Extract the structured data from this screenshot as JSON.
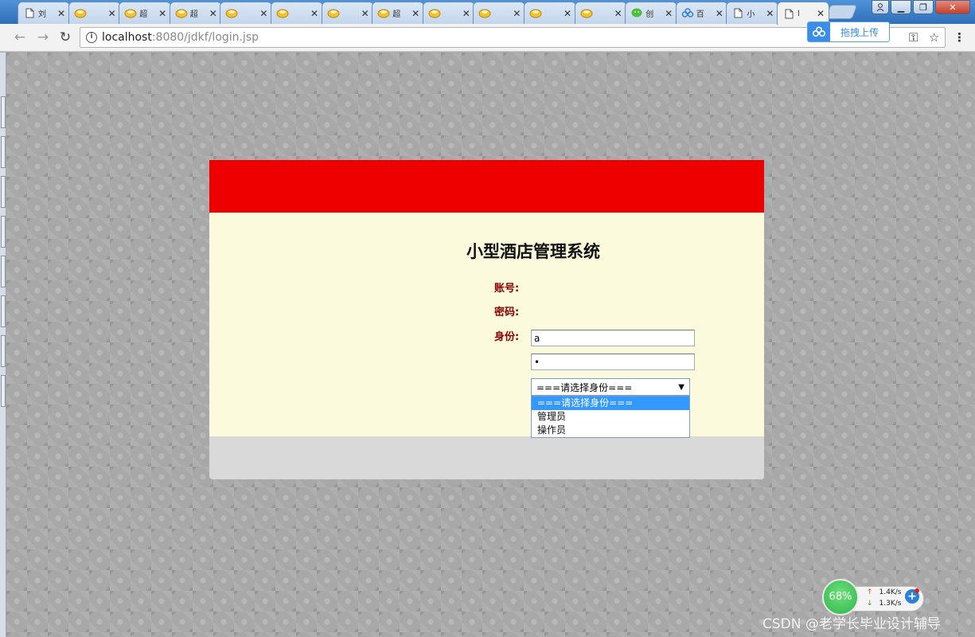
{
  "browser": {
    "tabs": [
      {
        "title": "刘",
        "icon": "page-icon"
      },
      {
        "title": "",
        "icon": "cup-icon"
      },
      {
        "title": "超",
        "icon": "cup-icon"
      },
      {
        "title": "超",
        "icon": "cup-icon"
      },
      {
        "title": "",
        "icon": "cup-icon"
      },
      {
        "title": "",
        "icon": "cup-icon"
      },
      {
        "title": "",
        "icon": "cup-icon"
      },
      {
        "title": "超",
        "icon": "cup-icon"
      },
      {
        "title": "",
        "icon": "cup-icon"
      },
      {
        "title": "",
        "icon": "cup-icon"
      },
      {
        "title": "",
        "icon": "cup-icon"
      },
      {
        "title": "",
        "icon": "cup-icon"
      },
      {
        "title": "创",
        "icon": "wechat-icon"
      },
      {
        "title": "百",
        "icon": "baidu-cloud-icon"
      },
      {
        "title": "小",
        "icon": "page-icon"
      },
      {
        "title": "l",
        "icon": "page-icon",
        "active": true
      }
    ],
    "tab_close": "✕",
    "url_host": "localhost",
    "url_rest": ":8080/jdkf/login.jsp",
    "upload_label": "拖拽上传",
    "nav_back": "←",
    "nav_forward": "→",
    "nav_reload": "↻",
    "menu_glyph": "⋮",
    "key_glyph": "⚿",
    "star_glyph": "☆"
  },
  "login": {
    "title": "小型酒店管理系统",
    "account_label": "账号:",
    "account_value": "a",
    "password_label": "密码:",
    "password_value": "a",
    "role_label": "身份:",
    "role_selected": "===请选择身份===",
    "role_options": [
      "===请选择身份===",
      "管理员",
      "操作员"
    ]
  },
  "colors": {
    "header": "#ee0000",
    "body": "#fcfadc",
    "footer": "#d9d9d9",
    "label": "#8b0000",
    "option_highlight": "#3399ff"
  },
  "network_widget": {
    "percent": "68%",
    "upload_speed": "1.4K/s",
    "download_speed": "1.3K/s"
  },
  "watermark": "CSDN @老学长毕业设计辅导"
}
